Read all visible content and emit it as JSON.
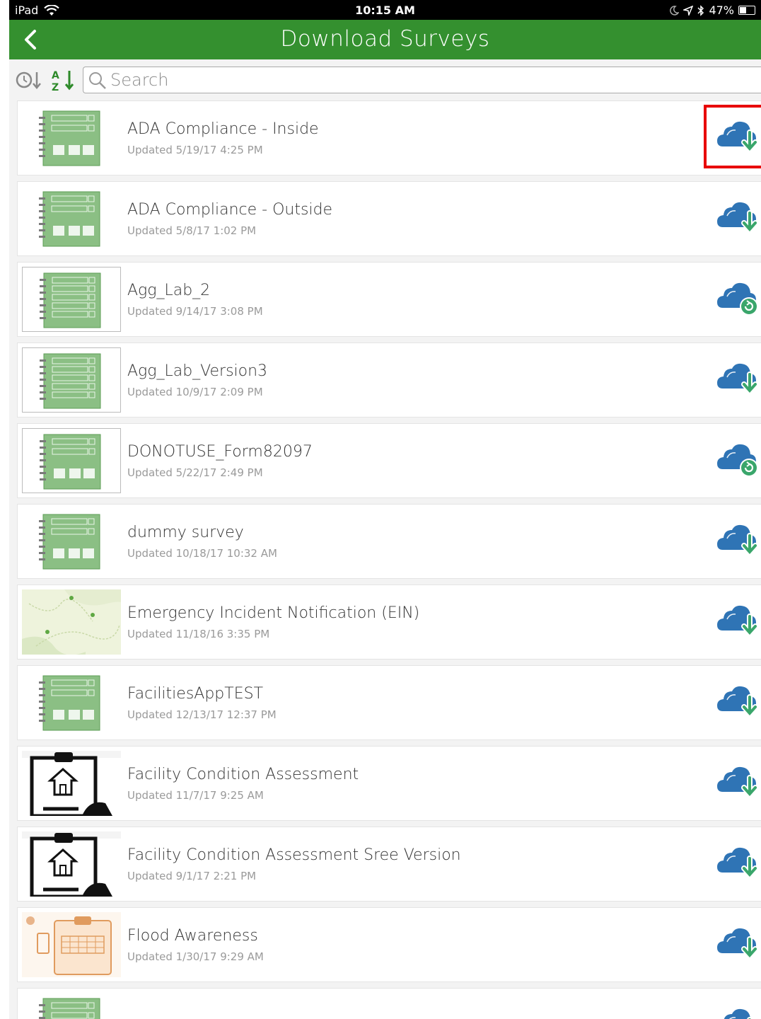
{
  "status_bar": {
    "device": "iPad",
    "time": "10:15 AM",
    "battery": "47%"
  },
  "nav": {
    "title": "Download Surveys"
  },
  "search": {
    "placeholder": "Search"
  },
  "colors": {
    "nav_green": "#34902f",
    "cloud_blue": "#2f74b5",
    "arrow_green": "#3aa66b",
    "highlight_red": "#e80000"
  },
  "surveys": [
    {
      "title": "ADA Compliance - Inside",
      "updated": "Updated 5/19/17 4:25 PM",
      "thumb": "form-media-icon",
      "action": "cloud-download-icon"
    },
    {
      "title": "ADA Compliance - Outside",
      "updated": "Updated 5/8/17 1:02 PM",
      "thumb": "form-media-icon",
      "action": "cloud-download-icon"
    },
    {
      "title": "Agg_Lab_2",
      "updated": "Updated 9/14/17 3:08 PM",
      "thumb": "form-checklist-icon",
      "action": "cloud-refresh-icon"
    },
    {
      "title": "Agg_Lab_Version3",
      "updated": "Updated 10/9/17 2:09 PM",
      "thumb": "form-checklist-icon",
      "action": "cloud-download-icon"
    },
    {
      "title": "DONOTUSE_Form82097",
      "updated": "Updated 5/22/17 2:49 PM",
      "thumb": "form-media-icon",
      "action": "cloud-refresh-icon"
    },
    {
      "title": "dummy survey",
      "updated": "Updated 10/18/17 10:32 AM",
      "thumb": "form-media-icon",
      "action": "cloud-download-icon"
    },
    {
      "title": "Emergency Incident Notification (EIN)",
      "updated": "Updated 11/18/16 3:35 PM",
      "thumb": "map-thumbnail",
      "action": "cloud-download-icon"
    },
    {
      "title": "FacilitiesAppTEST",
      "updated": "Updated 12/13/17 12:37 PM",
      "thumb": "form-media-icon",
      "action": "cloud-download-icon"
    },
    {
      "title": "Facility Condition Assessment",
      "updated": "Updated 11/7/17 9:25 AM",
      "thumb": "clipboard-house-icon",
      "action": "cloud-download-icon"
    },
    {
      "title": "Facility Condition Assessment Sree Version",
      "updated": "Updated 9/1/17 2:21 PM",
      "thumb": "clipboard-house-icon",
      "action": "cloud-download-icon"
    },
    {
      "title": "Flood Awareness",
      "updated": "Updated 1/30/17 9:29 AM",
      "thumb": "flood-thumbnail",
      "action": "cloud-download-icon"
    },
    {
      "title": "",
      "updated": "",
      "thumb": "form-media-icon",
      "action": "cloud-download-icon"
    }
  ]
}
